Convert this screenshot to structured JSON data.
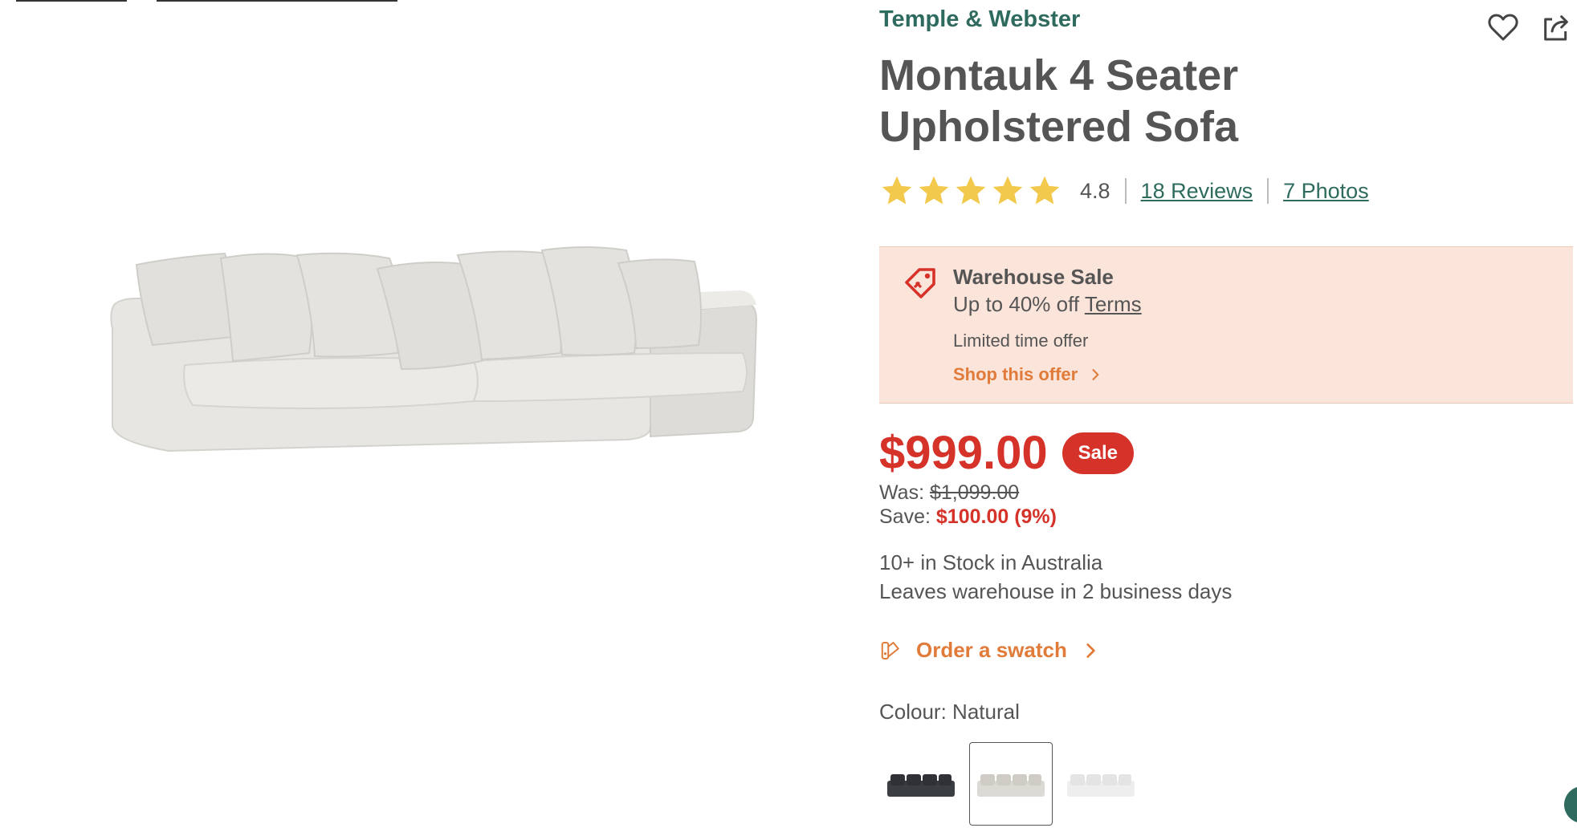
{
  "colors": {
    "brand_green": "#2e6b5e",
    "sale_red": "#d5332a",
    "promo_bg": "#fbe4da",
    "accent_orange": "#e07b3a",
    "star_gold": "#f2c94c"
  },
  "product": {
    "brand": "Temple & Webster",
    "title": "Montauk 4 Seater Upholstered Sofa",
    "rating": "4.8",
    "stars_filled": 5,
    "reviews_link": "18 Reviews",
    "photos_link": "7 Photos"
  },
  "promo": {
    "icon": "tag-icon",
    "title": "Warehouse Sale",
    "subtitle": "Up to 40% off",
    "terms": "Terms",
    "limited": "Limited time offer",
    "shop": "Shop this offer"
  },
  "pricing": {
    "price": "$999.00",
    "badge": "Sale",
    "was_label": "Was:",
    "was_value": "$1,099.00",
    "save_label": "Save:",
    "save_value": "$100.00 (9%)"
  },
  "stock": {
    "line1": "10+ in Stock in Australia",
    "line2": "Leaves warehouse in 2 business days"
  },
  "swatch_link": "Order a swatch",
  "colour": {
    "label": "Colour: Natural",
    "options": [
      "charcoal",
      "natural",
      "white"
    ],
    "selected": "natural"
  },
  "icons": {
    "wishlist": "heart-icon",
    "share": "share-icon",
    "chevron": "chevron-right-icon",
    "swatch": "swatch-icon"
  }
}
